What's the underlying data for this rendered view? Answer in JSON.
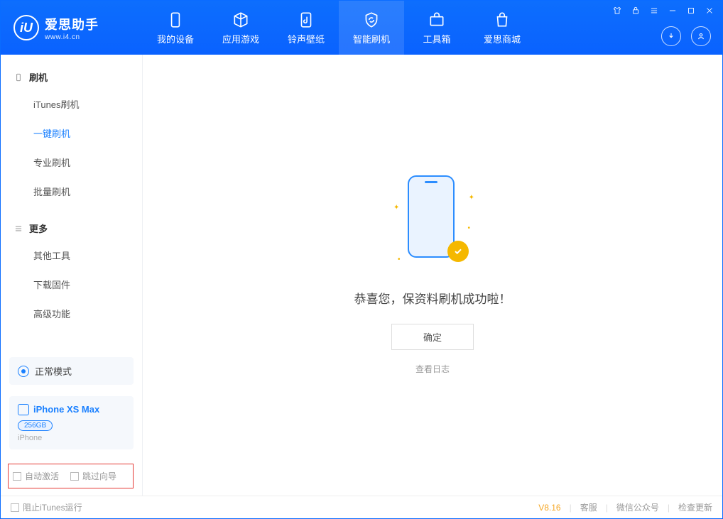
{
  "app": {
    "title": "爱思助手",
    "subtitle": "www.i4.cn",
    "logo_letter": "iU"
  },
  "tabs": {
    "device": "我的设备",
    "apps": "应用游戏",
    "ringtone": "铃声壁纸",
    "flash": "智能刷机",
    "toolbox": "工具箱",
    "store": "爱思商城"
  },
  "sidebar": {
    "group1": {
      "title": "刷机",
      "items": [
        "iTunes刷机",
        "一键刷机",
        "专业刷机",
        "批量刷机"
      ]
    },
    "group2": {
      "title": "更多",
      "items": [
        "其他工具",
        "下载固件",
        "高级功能"
      ]
    },
    "mode": "正常模式",
    "device": {
      "name": "iPhone XS Max",
      "capacity": "256GB",
      "type": "iPhone"
    },
    "checkboxes": {
      "auto_activate": "自动激活",
      "skip_guide": "跳过向导"
    }
  },
  "main": {
    "message": "恭喜您，保资料刷机成功啦！",
    "ok": "确定",
    "view_log": "查看日志"
  },
  "footer": {
    "block_itunes": "阻止iTunes运行",
    "version": "V8.16",
    "support": "客服",
    "wechat": "微信公众号",
    "check_update": "检查更新"
  }
}
